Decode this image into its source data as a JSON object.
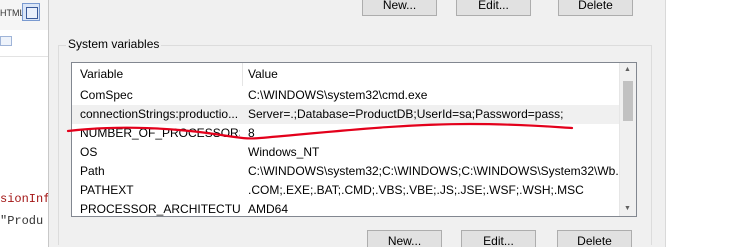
{
  "ide": {
    "toolbar_label": "HTML:",
    "code_line1": "sionInf",
    "code_line2": "\"Produ"
  },
  "top_buttons": {
    "new": "New...",
    "edit": "Edit...",
    "delete": "Delete"
  },
  "system_variables": {
    "title": "System variables",
    "columns": {
      "variable": "Variable",
      "value": "Value"
    },
    "rows": [
      {
        "name": "ComSpec",
        "value": "C:\\WINDOWS\\system32\\cmd.exe"
      },
      {
        "name": "connectionStrings:productio...",
        "value": "Server=.;Database=ProductDB;UserId=sa;Password=pass;"
      },
      {
        "name": "NUMBER_OF_PROCESSORS",
        "value": "8"
      },
      {
        "name": "OS",
        "value": "Windows_NT"
      },
      {
        "name": "Path",
        "value": "C:\\WINDOWS\\system32;C:\\WINDOWS;C:\\WINDOWS\\System32\\Wb..."
      },
      {
        "name": "PATHEXT",
        "value": ".COM;.EXE;.BAT;.CMD;.VBS;.VBE;.JS;.JSE;.WSF;.WSH;.MSC"
      },
      {
        "name": "PROCESSOR_ARCHITECTURE",
        "value": "AMD64"
      }
    ],
    "selected_row": 1
  },
  "bottom_buttons": {
    "new": "New...",
    "edit": "Edit...",
    "delete": "Delete"
  },
  "colors": {
    "annotation": "#e3001b",
    "dialog_bg": "#f0f0f0"
  }
}
